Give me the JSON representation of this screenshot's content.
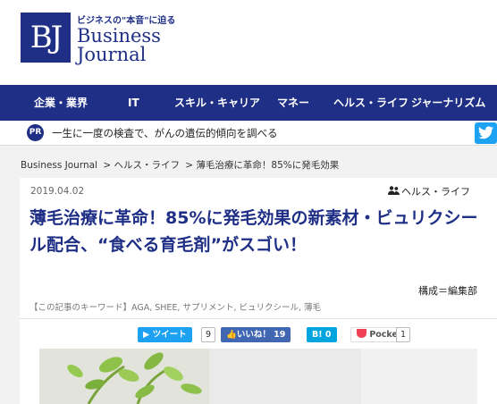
{
  "logo": {
    "mark": "BJ",
    "tagline": "ビジネスの\"本音\"に迫る",
    "name_line1": "Business",
    "name_line2": "Journal"
  },
  "nav": [
    "企業・業界",
    "IT",
    "スキル・キャリア",
    "マネー",
    "ヘルス・ライフ",
    "ジャーナリズム"
  ],
  "ticker": {
    "badge": "PR",
    "text": "一生に一度の検査で、がんの遺伝的傾向を調べる"
  },
  "breadcrumb": [
    "Business Journal",
    "> ヘルス・ライフ",
    "> 薄毛治療に革命！85%に発毛効果"
  ],
  "article": {
    "date": "2019.04.02",
    "category": "ヘルス・ライフ",
    "title": "薄毛治療に革命！85%に発毛効果の新素材・ビュリクシール配合、“食べる育毛剤”がスゴい！",
    "author": "構成＝編集部",
    "keywords": "【この記事のキーワード】AGA, SHEE, サプリメント, ビュリクシール, 薄毛"
  },
  "share": {
    "tweet_label": "ツイート",
    "tweet_count": "9",
    "like_label": "いいね！",
    "like_count": "19",
    "hatena_label": "B! 0",
    "pocket_label": "Pocket",
    "pocket_count": "1"
  },
  "colors": {
    "brand": "#1f2f86",
    "twitter": "#1da1f2",
    "facebook": "#4267b2",
    "hatena": "#00a4de",
    "pocket": "#ef4056"
  }
}
